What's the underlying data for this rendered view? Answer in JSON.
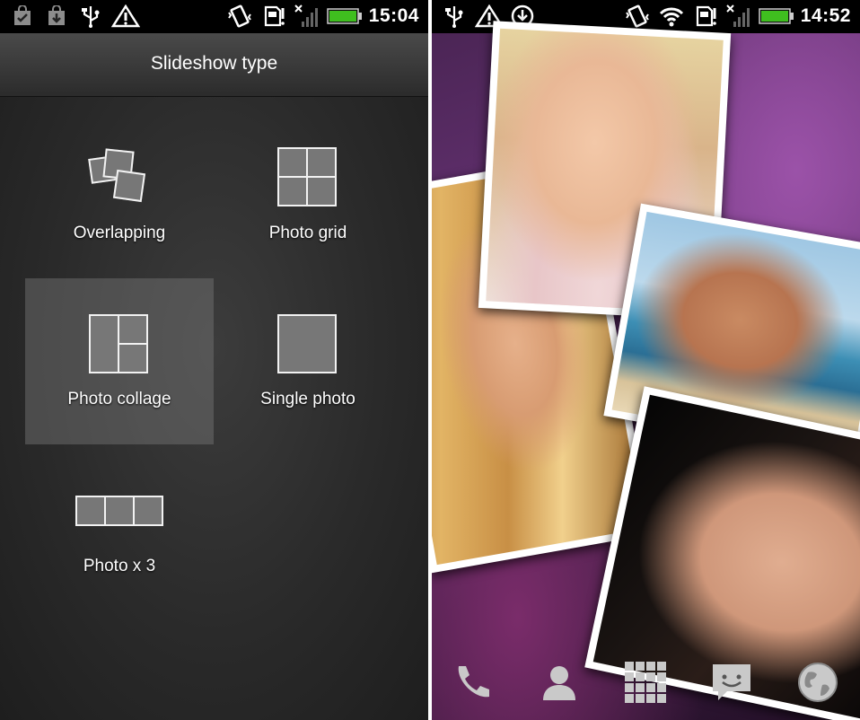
{
  "left_screen": {
    "status_bar": {
      "time": "15:04",
      "icons": [
        "shopping-bag-check-icon",
        "shopping-bag-download-icon",
        "usb-icon",
        "warning-triangle-icon",
        "vibrate-icon",
        "sd-card-icon",
        "no-signal-icon",
        "battery-icon"
      ]
    },
    "title": "Slideshow type",
    "options": [
      {
        "label": "Overlapping"
      },
      {
        "label": "Photo grid"
      },
      {
        "label": "Photo collage"
      },
      {
        "label": "Single photo"
      },
      {
        "label": "Photo x 3"
      }
    ],
    "selected_option": "Photo collage"
  },
  "right_screen": {
    "status_bar": {
      "time": "14:52",
      "icons": [
        "usb-icon",
        "warning-triangle-icon",
        "sync-icon",
        "vibrate-icon",
        "wifi-icon",
        "sd-card-icon",
        "no-signal-icon",
        "battery-icon"
      ]
    },
    "dock": [
      "phone-icon",
      "people-icon",
      "all-apps-icon",
      "messages-icon",
      "browser-icon"
    ]
  }
}
